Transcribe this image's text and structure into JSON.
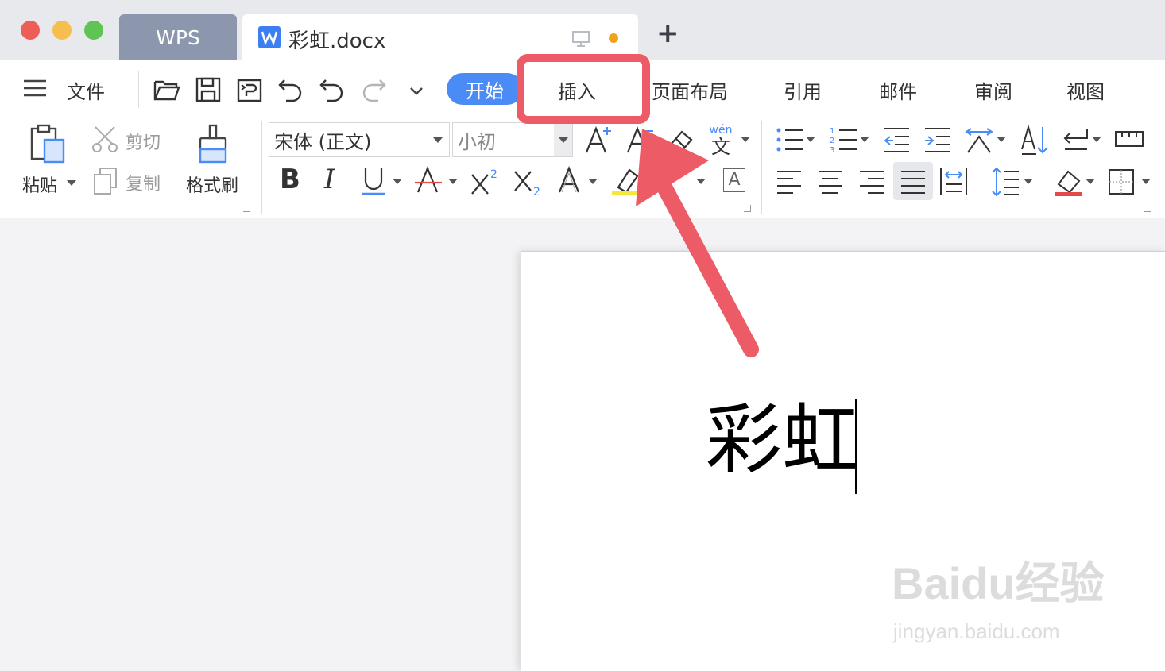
{
  "window": {
    "traffic_lights": {
      "close": "#ee5e57",
      "minimize": "#f5be4f",
      "zoom": "#5fc454"
    },
    "tabs": [
      {
        "label": "WPS"
      },
      {
        "label": "彩虹.docx"
      }
    ],
    "new_tab_label": "+"
  },
  "toolbar": {
    "menu_label": "文件",
    "ribbon_tabs": [
      {
        "label": "开始",
        "active": true
      },
      {
        "label": "插入"
      },
      {
        "label": "页面布局"
      },
      {
        "label": "引用"
      },
      {
        "label": "邮件"
      },
      {
        "label": "审阅"
      },
      {
        "label": "视图"
      }
    ]
  },
  "clipboard": {
    "paste": "粘贴",
    "cut": "剪切",
    "copy": "复制",
    "format_painter": "格式刷"
  },
  "font": {
    "family": "宋体 (正文)",
    "size": "小初",
    "phonetic_top": "wén",
    "phonetic_bottom": "文",
    "char_border": "A"
  },
  "document": {
    "text": "彩虹"
  },
  "watermark": {
    "brand": "Baidu经验",
    "url": "jingyan.baidu.com"
  },
  "colors": {
    "accent": "#4a8bf5",
    "annotation": "#ec5b66"
  }
}
